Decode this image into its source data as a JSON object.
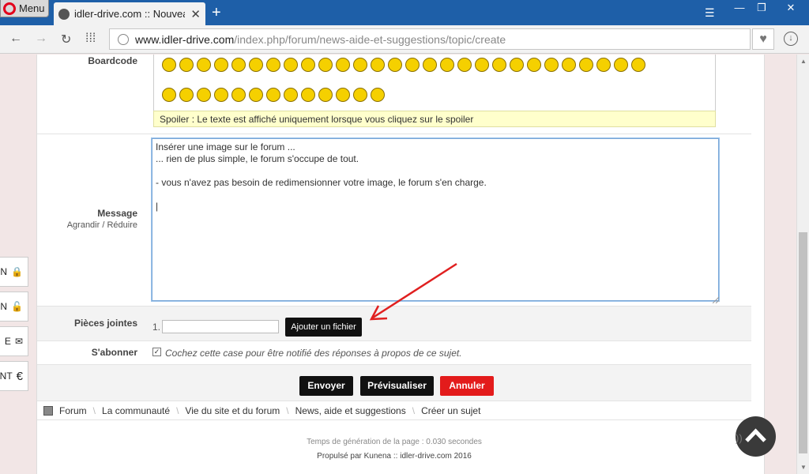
{
  "browser": {
    "menu_label": "Menu",
    "tab_title": "idler-drive.com :: Nouveau",
    "tab_close": "✕",
    "new_tab": "+",
    "url_domain": "www.idler-drive.com",
    "url_path": "/index.php/forum/news-aide-et-suggestions/topic/create",
    "window": {
      "minimize": "—",
      "maximize": "❐",
      "close": "✕"
    }
  },
  "form": {
    "boardcode_label": "Boardcode",
    "spoiler_text": "Spoiler : Le texte est affiché uniquement lorsque vous cliquez sur le spoiler",
    "message_label": "Message",
    "enlarge_label": "Agrandir",
    "reduce_label": "Réduire",
    "enlarge_sep": "/",
    "message_value": "Insérer une image sur le forum ...\n... rien de plus simple, le forum s'occupe de tout.\n\n- vous n'avez pas besoin de redimensionner votre image, le forum s'en charge.\n\n|",
    "attachments_label": "Pièces jointes",
    "attachment_index": "1.",
    "add_file_button": "Ajouter un fichier",
    "subscribe_label": "S'abonner",
    "subscribe_text": "Cochez cette case pour être notifié des réponses à propos de ce sujet.",
    "subscribe_checked": true,
    "send_button": "Envoyer",
    "preview_button": "Prévisualiser",
    "cancel_button": "Annuler"
  },
  "breadcrumb": [
    "Forum",
    "La communauté",
    "Vie du site et du forum",
    "News, aide et suggestions",
    "Créer un sujet"
  ],
  "footer": {
    "generation_time": "Temps de génération de la page : 0.030 secondes",
    "powered": "Propulsé par Kunena :: idler-drive.com 2016"
  },
  "side_buttons": [
    {
      "label": "N",
      "icon": "lock-icon"
    },
    {
      "label": "N",
      "icon": "unlock-icon"
    },
    {
      "label": "E",
      "icon": "envelope-icon"
    },
    {
      "label": "NT",
      "icon": "euro-icon"
    }
  ],
  "colors": {
    "accent_red": "#e31b1b",
    "button_black": "#111111",
    "spoiler_bg": "#ffffcc",
    "annotation_arrow": "#e02020"
  }
}
